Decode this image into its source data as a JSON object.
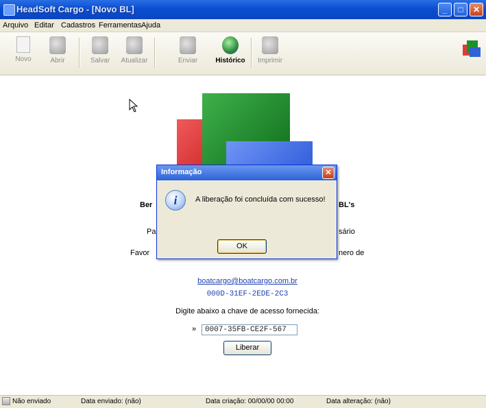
{
  "window": {
    "title": "HeadSoft Cargo - [Novo BL]",
    "minimize": "_",
    "maximize": "□",
    "close": "✕"
  },
  "menu": [
    "Arquivo",
    "Editar",
    "Cadastros",
    "Ferramentas",
    "Ajuda"
  ],
  "toolbar": {
    "novo": "Novo",
    "abrir": "Abrir",
    "salvar": "Salvar",
    "atualizar": "Atualizar",
    "enviar": "Enviar",
    "historico": "Histórico",
    "imprimir": "Imprimir"
  },
  "content": {
    "welcome_left": "Ber",
    "welcome_right": "BL's",
    "para_left": "Par",
    "para_right": "sário",
    "favor_left": "Favor",
    "favor_right": "nero de",
    "email": "boatcargo@boatcargo.com.br",
    "request_code": "000D-31EF-2EDE-2C3",
    "prompt": "Digite abaixo a chave de acesso fornecida:",
    "key_marker": "»",
    "key_value": "0007-35FB-CE2F-567",
    "liberar_button": "Liberar"
  },
  "dialog": {
    "title": "Informação",
    "icon": "i",
    "message": "A liberação foi concluída com sucesso!",
    "ok_button": "OK"
  },
  "status": {
    "sent": "Não enviado",
    "sent_date": "Data enviado: (não)",
    "created_date": "Data criação: 00/00/00 00:00",
    "changed_date": "Data alteração: (não)"
  },
  "colors": {
    "titlebar": "#0a4fd0",
    "logo_red": "#c41b1b",
    "logo_green": "#0f6e1c",
    "logo_blue": "#2a58d8",
    "link": "#1b3fb0"
  }
}
